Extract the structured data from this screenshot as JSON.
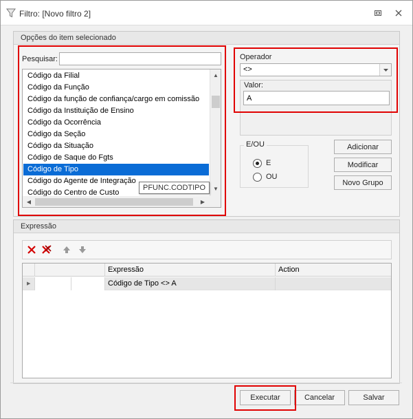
{
  "window": {
    "title": "Filtro: [Novo filtro 2]"
  },
  "options_group": {
    "header": "Opções do item selecionado",
    "search_label": "Pesquisar:",
    "search_value": "",
    "items": [
      "Código da Filial",
      "Código da Função",
      "Código da função de confiança/cargo em comissão",
      "Código da Instituição de Ensino",
      "Código da Ocorrência",
      "Código da Seção",
      "Código da Situação",
      "Código de Saque do Fgts",
      "Código de Tipo",
      "Código do Agente de Integração",
      "Código do Centro de Custo"
    ],
    "selected_index": 8,
    "tooltip": "PFUNC.CODTIPO"
  },
  "operator": {
    "label": "Operador",
    "value": "<>"
  },
  "value_field": {
    "label": "Valor:",
    "value": "A"
  },
  "logic": {
    "legend": "E/OU",
    "option_and": "E",
    "option_or": "OU",
    "selected": "E"
  },
  "side_buttons": {
    "add": "Adicionar",
    "modify": "Modificar",
    "new_group": "Novo Grupo"
  },
  "expression_group": {
    "header": "Expressão",
    "columns": [
      "",
      "",
      "Expressão",
      "Action"
    ],
    "rows": [
      {
        "expression": "Código de Tipo <> A",
        "action": ""
      }
    ]
  },
  "footer": {
    "execute": "Executar",
    "cancel": "Cancelar",
    "save": "Salvar"
  },
  "colors": {
    "highlight_red": "#e00000",
    "selection_blue": "#0a6cd6"
  }
}
